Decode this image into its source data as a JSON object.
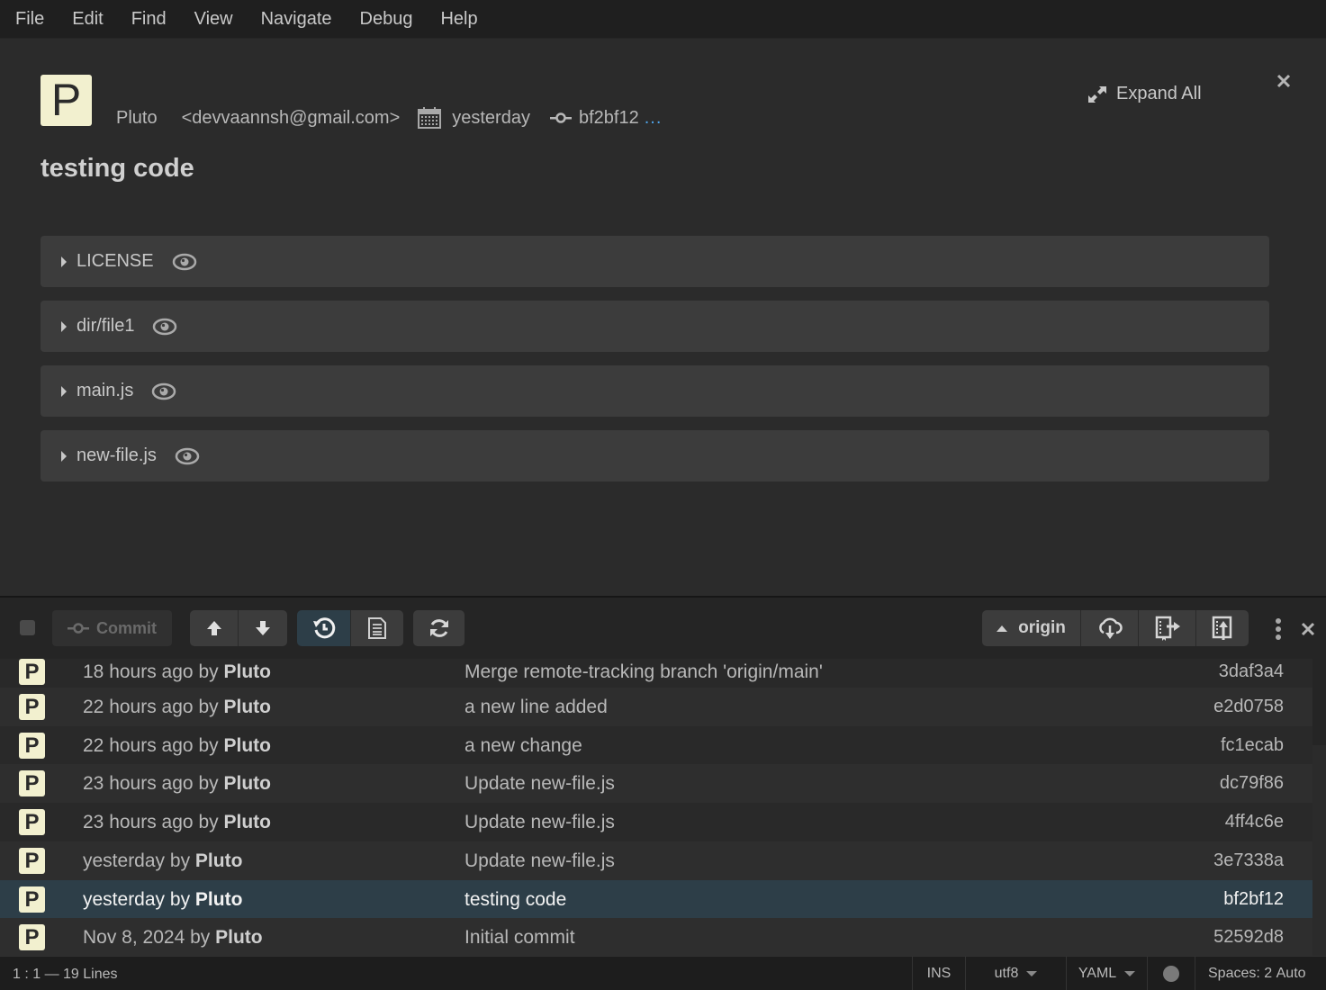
{
  "menu": [
    "File",
    "Edit",
    "Find",
    "View",
    "Navigate",
    "Debug",
    "Help"
  ],
  "detail": {
    "avatar_letter": "P",
    "author": "Pluto",
    "email": "<devvaannsh@gmail.com>",
    "date": "yesterday",
    "sha": "bf2bf12",
    "more": "...",
    "title": "testing code",
    "expand_all_label": "Expand All",
    "files": [
      "LICENSE",
      "dir/file1",
      "main.js",
      "new-file.js"
    ]
  },
  "toolbar": {
    "commit_label": "Commit",
    "remote_label": "origin"
  },
  "history": [
    {
      "avatar": "P",
      "when": "18 hours ago",
      "by": "by",
      "author": "Pluto",
      "message": "Merge remote-tracking branch 'origin/main'",
      "sha": "3daf3a4"
    },
    {
      "avatar": "P",
      "when": "22 hours ago",
      "by": "by",
      "author": "Pluto",
      "message": "a new line added",
      "sha": "e2d0758"
    },
    {
      "avatar": "P",
      "when": "22 hours ago",
      "by": "by",
      "author": "Pluto",
      "message": "a new change",
      "sha": "fc1ecab"
    },
    {
      "avatar": "P",
      "when": "23 hours ago",
      "by": "by",
      "author": "Pluto",
      "message": "Update new-file.js",
      "sha": "dc79f86"
    },
    {
      "avatar": "P",
      "when": "23 hours ago",
      "by": "by",
      "author": "Pluto",
      "message": "Update new-file.js",
      "sha": "4ff4c6e"
    },
    {
      "avatar": "P",
      "when": "yesterday",
      "by": "by",
      "author": "Pluto",
      "message": "Update new-file.js",
      "sha": "3e7338a"
    },
    {
      "avatar": "P",
      "when": "yesterday",
      "by": "by",
      "author": "Pluto",
      "message": "testing code",
      "sha": "bf2bf12",
      "selected": true
    },
    {
      "avatar": "P",
      "when": "Nov 8, 2024",
      "by": "by",
      "author": "Pluto",
      "message": "Initial commit",
      "sha": "52592d8"
    }
  ],
  "status": {
    "position": "1 : 1 — 19 Lines",
    "mode": "INS",
    "encoding": "utf8",
    "language": "YAML",
    "spaces_label": "Spaces:",
    "spaces_value": "2",
    "indent_mode": "Auto"
  },
  "colors": {
    "accent_link": "#4ea3e8",
    "selected_row": "#2d3e48",
    "avatar_bg": "#f2f0cf"
  }
}
